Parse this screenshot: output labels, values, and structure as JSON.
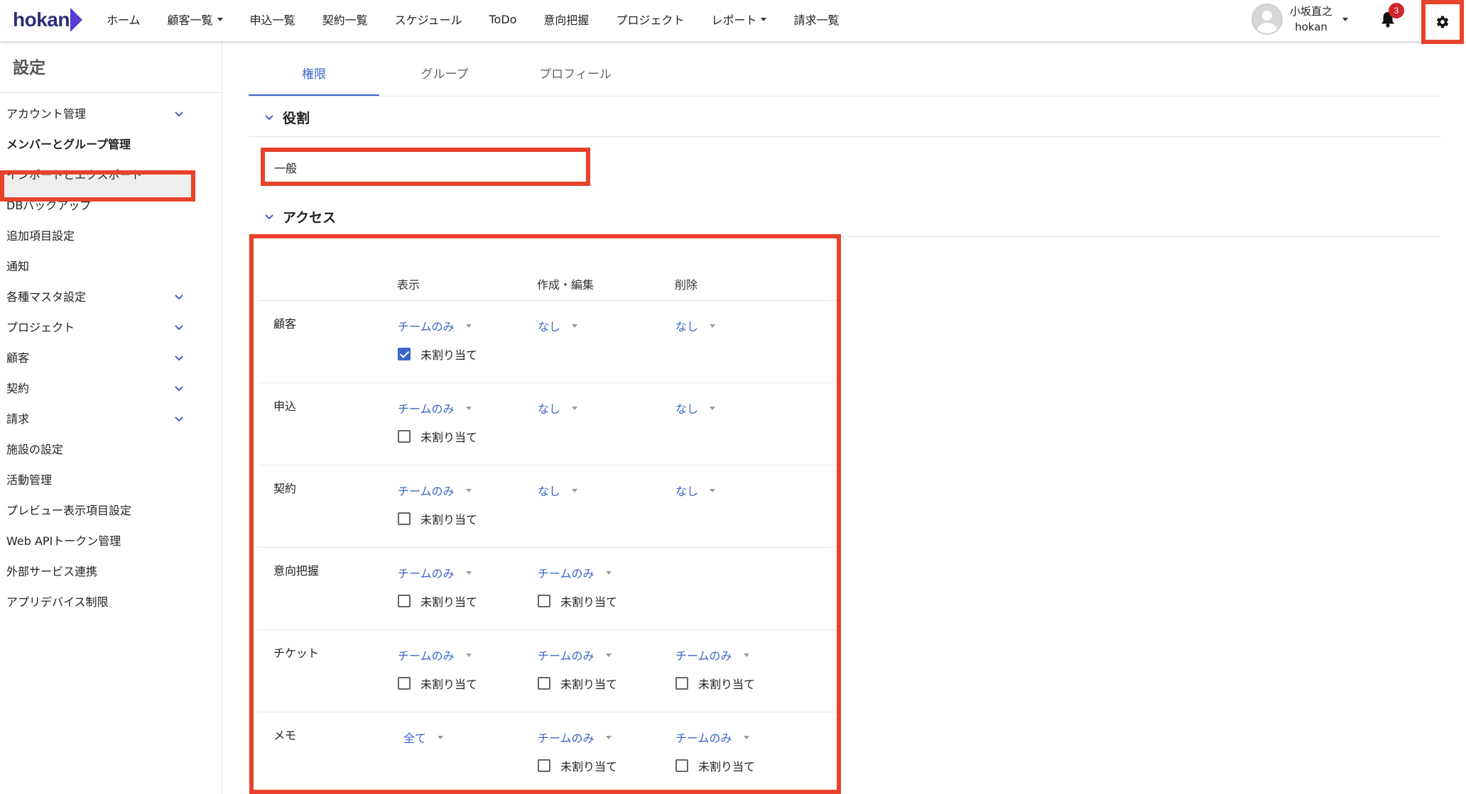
{
  "nav": {
    "logo": "hokan",
    "items": [
      "ホーム",
      "顧客一覧",
      "申込一覧",
      "契約一覧",
      "スケジュール",
      "ToDo",
      "意向把握",
      "プロジェクト",
      "レポート",
      "請求一覧"
    ],
    "dropdown_items": [
      1,
      8
    ],
    "user_name": "小坂直之",
    "user_org": "hokan",
    "notification_count": "3"
  },
  "sidebar": {
    "title": "設定",
    "items": [
      {
        "label": "アカウント管理",
        "expandable": true
      },
      {
        "label": "メンバーとグループ管理",
        "expandable": false,
        "active": true
      },
      {
        "label": "インポートとエクスポート",
        "expandable": false
      },
      {
        "label": "DBバックアップ",
        "expandable": false
      },
      {
        "label": "追加項目設定",
        "expandable": false
      },
      {
        "label": "通知",
        "expandable": false
      },
      {
        "label": "各種マスタ設定",
        "expandable": true
      },
      {
        "label": "プロジェクト",
        "expandable": true
      },
      {
        "label": "顧客",
        "expandable": true
      },
      {
        "label": "契約",
        "expandable": true
      },
      {
        "label": "請求",
        "expandable": true
      },
      {
        "label": "施設の設定",
        "expandable": false
      },
      {
        "label": "活動管理",
        "expandable": false
      },
      {
        "label": "プレビュー表示項目設定",
        "expandable": false
      },
      {
        "label": "Web APIトークン管理",
        "expandable": false
      },
      {
        "label": "外部サービス連携",
        "expandable": false
      },
      {
        "label": "アプリデバイス制限",
        "expandable": false
      }
    ]
  },
  "tabs": [
    {
      "label": "権限",
      "active": true
    },
    {
      "label": "グループ",
      "active": false
    },
    {
      "label": "プロフィール",
      "active": false
    }
  ],
  "role_section": {
    "title": "役割",
    "value": "一般"
  },
  "access_section": {
    "title": "アクセス",
    "columns": [
      "表示",
      "作成・編集",
      "削除"
    ],
    "rows": [
      {
        "label": "顧客",
        "cells": [
          {
            "value": "チームのみ",
            "unassigned": true
          },
          {
            "value": "なし"
          },
          {
            "value": "なし"
          }
        ]
      },
      {
        "label": "申込",
        "cells": [
          {
            "value": "チームのみ",
            "unassigned": false
          },
          {
            "value": "なし"
          },
          {
            "value": "なし"
          }
        ]
      },
      {
        "label": "契約",
        "cells": [
          {
            "value": "チームのみ",
            "unassigned": false
          },
          {
            "value": "なし"
          },
          {
            "value": "なし"
          }
        ]
      },
      {
        "label": "意向把握",
        "cells": [
          {
            "value": "チームのみ",
            "unassigned": false
          },
          {
            "value": "チームのみ",
            "unassigned": false
          },
          null
        ]
      },
      {
        "label": "チケット",
        "cells": [
          {
            "value": "チームのみ",
            "unassigned": false
          },
          {
            "value": "チームのみ",
            "unassigned": false
          },
          {
            "value": "チームのみ",
            "unassigned": false
          }
        ]
      },
      {
        "label": "メモ",
        "cells": [
          {
            "value": "全て"
          },
          {
            "value": "チームのみ",
            "unassigned": false
          },
          {
            "value": "チームのみ",
            "unassigned": false
          }
        ]
      }
    ],
    "unassigned_label": "未割り当て"
  },
  "colors": {
    "accent": "#3b65c8",
    "highlight": "#e8412c",
    "badge": "#d0262d",
    "logo": "#2b2d7a"
  }
}
